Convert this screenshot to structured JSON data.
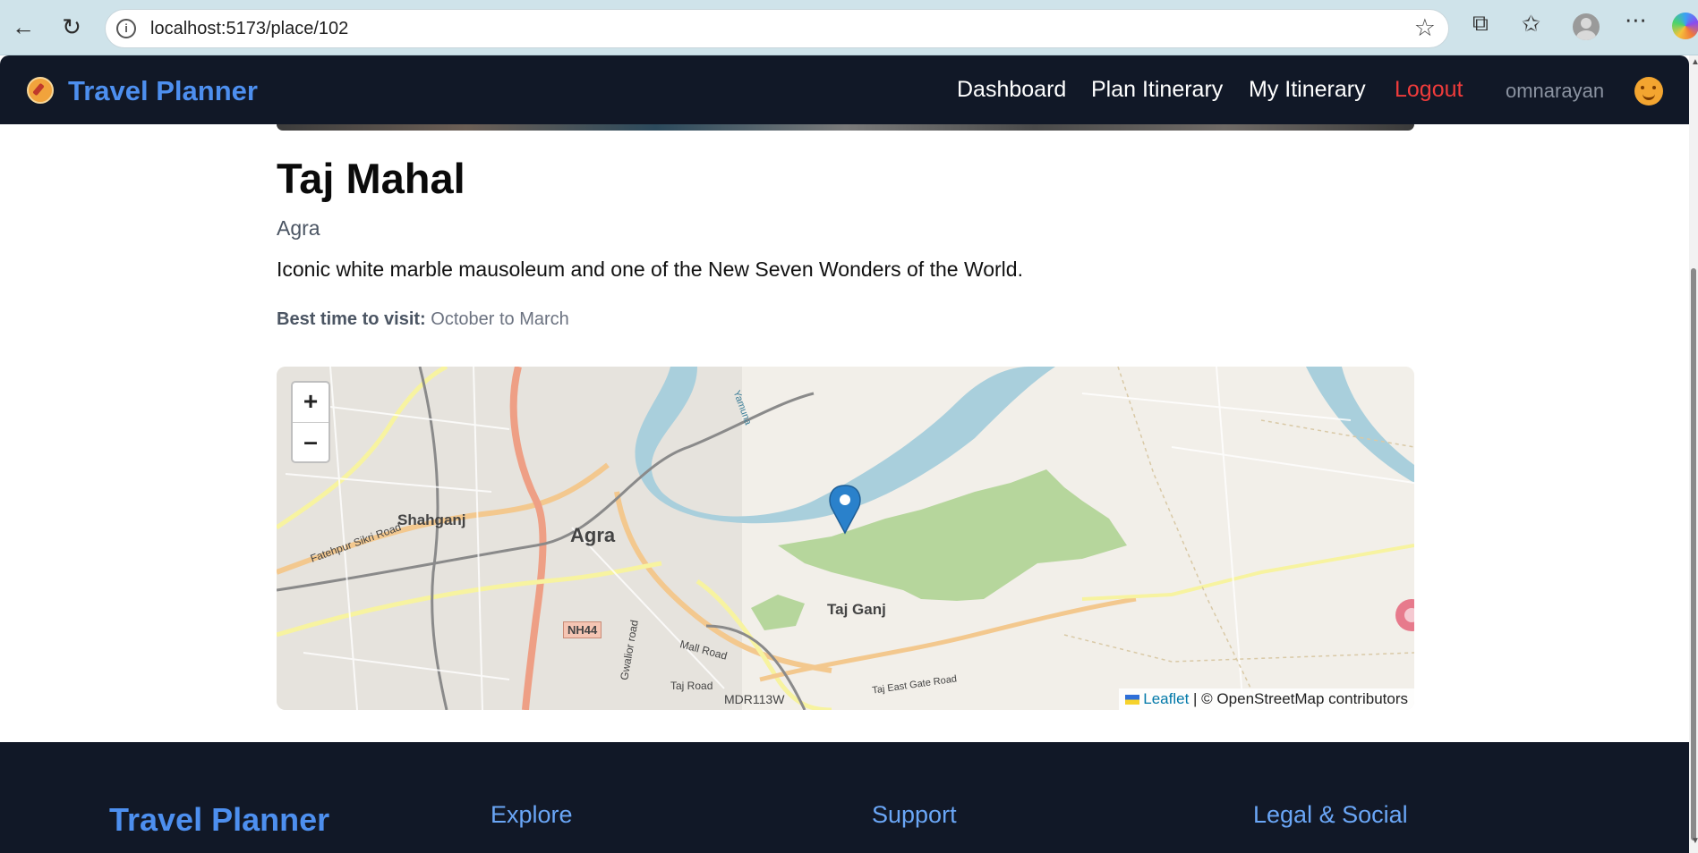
{
  "browser": {
    "url": "localhost:5173/place/102",
    "back_icon": "arrow-left-icon",
    "reload_icon": "reload-icon"
  },
  "nav": {
    "brand": "Travel Planner",
    "links": [
      "Dashboard",
      "Plan Itinerary",
      "My Itinerary"
    ],
    "logout": "Logout",
    "username": "omnarayan"
  },
  "place": {
    "name": "Taj Mahal",
    "city": "Agra",
    "description": "Iconic white marble mausoleum and one of the New Seven Wonders of the World.",
    "best_time_label": "Best time to visit:",
    "best_time_value": "October to March"
  },
  "map": {
    "zoom_in": "+",
    "zoom_out": "–",
    "labels": {
      "shahganj": "Shahganj",
      "agra": "Agra",
      "taj_ganj": "Taj Ganj",
      "nh44": "NH44",
      "fatehpur": "Fatehpur Sikri Road",
      "mall_road": "Mall Road",
      "taj_road": "Taj Road",
      "gwalior_road": "Gwalior road",
      "mdr": "MDR113W",
      "taj_east_gate": "Taj East Gate Road",
      "yamuna": "Yamuna"
    },
    "attribution_leaflet": "Leaflet",
    "attribution_rest": "| © OpenStreetMap contributors"
  },
  "footer": {
    "brand": "Travel Planner",
    "headings": [
      "Explore",
      "Support",
      "Legal & Social"
    ]
  },
  "colors": {
    "navbar_bg": "#111827",
    "brand_blue": "#4d8fef",
    "logout_red": "#ef3b3b",
    "river": "#a9cfdc",
    "park": "#a8d08d",
    "marker": "#2a81cb"
  }
}
